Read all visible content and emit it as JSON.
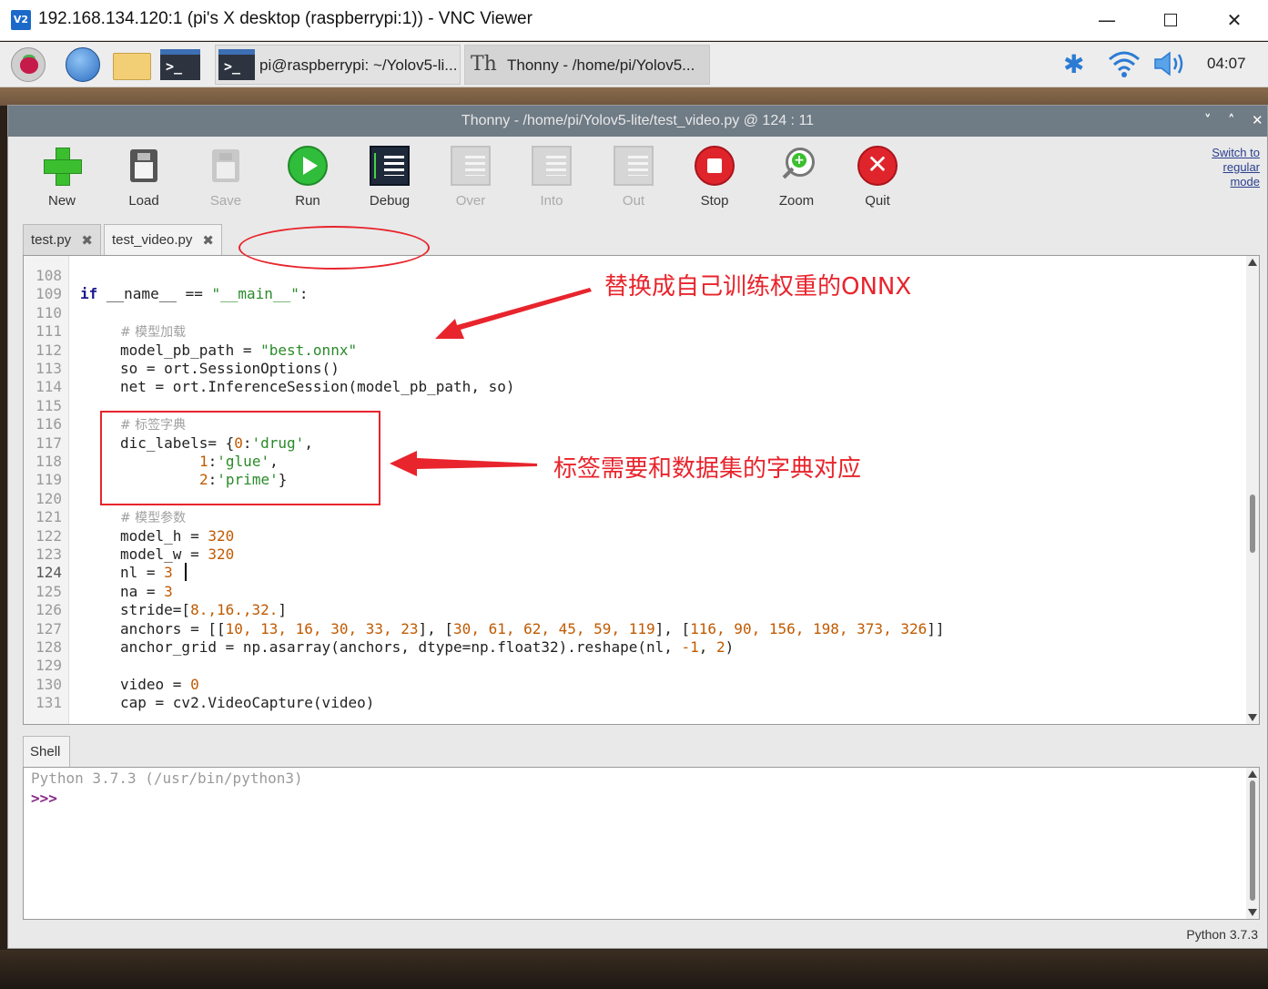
{
  "vnc": {
    "icon_text": "V2",
    "title": "192.168.134.120:1 (pi's X desktop (raspberrypi:1)) - VNC Viewer",
    "min": "—",
    "close": "✕"
  },
  "taskbar": {
    "terminal_prompt": ">_",
    "terminal_task": "pi@raspberrypi: ~/Yolov5-li...",
    "thonny_icon": "Th",
    "thonny_task": "Thonny  -  /home/pi/Yolov5...",
    "bluetooth_glyph": "✱",
    "clock": "04:07"
  },
  "thonny": {
    "title": "Thonny  -  /home/pi/Yolov5-lite/test_video.py  @  124 : 11",
    "ctrl_min": "˅",
    "ctrl_max": "˄",
    "ctrl_close": "✕",
    "toolbar": {
      "new": "New",
      "load": "Load",
      "save": "Save",
      "run": "Run",
      "debug": "Debug",
      "over": "Over",
      "into": "Into",
      "out": "Out",
      "stop": "Stop",
      "zoom": "Zoom",
      "quit": "Quit",
      "zoom_plus": "+",
      "quit_x": "✕"
    },
    "switch_mode": "Switch to regular mode",
    "tabs": [
      {
        "label": "test.py",
        "close": "✖"
      },
      {
        "label": "test_video.py",
        "close": "✖"
      }
    ],
    "line_numbers": [
      "108",
      "109",
      "110",
      "111",
      "112",
      "113",
      "114",
      "115",
      "116",
      "117",
      "118",
      "119",
      "120",
      "121",
      "122",
      "123",
      "124",
      "125",
      "126",
      "127",
      "128",
      "129",
      "130",
      "131"
    ],
    "code": {
      "l109_kw": "if",
      "l109_a": " __name__ == ",
      "l109_str": "\"__main__\"",
      "l109_b": ":",
      "l111": "# 模型加载",
      "l112_a": "model_pb_path = ",
      "l112_str": "\"best.onnx\"",
      "l113": "so = ort.SessionOptions()",
      "l114": "net = ort.InferenceSession(model_pb_path, so)",
      "l116": "# 标签字典",
      "l117_a": "dic_labels= {",
      "l117_n": "0",
      "l117_b": ":",
      "l117_s": "'drug'",
      "l117_c": ",",
      "l118_n": "1",
      "l118_b": ":",
      "l118_s": "'glue'",
      "l118_c": ",",
      "l119_n": "2",
      "l119_b": ":",
      "l119_s": "'prime'",
      "l119_c": "}",
      "l121": "# 模型参数",
      "l122_a": "model_h = ",
      "l122_n": "320",
      "l123_a": "model_w = ",
      "l123_n": "320",
      "l124_a": "nl = ",
      "l124_n": "3",
      "l125_a": "na = ",
      "l125_n": "3",
      "l126_a": "stride=[",
      "l126_n": "8.,16.,32.",
      "l126_b": "]",
      "l127_a": "anchors = [[",
      "l127_n1": "10, 13, 16, 30, 33, 23",
      "l127_b": "], [",
      "l127_n2": "30, 61, 62, 45, 59, 119",
      "l127_c": "], [",
      "l127_n3": "116, 90, 156, 198, 373, 326",
      "l127_d": "]]",
      "l128_a": "anchor_grid = np.asarray(anchors, dtype=np.float32).reshape(nl, ",
      "l128_n1": "-1",
      "l128_b": ", ",
      "l128_n2": "2",
      "l128_c": ")",
      "l130_a": "video = ",
      "l130_n": "0",
      "l131": "cap = cv2.VideoCapture(video)"
    },
    "annotations": {
      "onnx_note": "替换成自己训练权重的ONNX",
      "labels_note": "标签需要和数据集的字典对应"
    },
    "shell": {
      "tab": "Shell",
      "banner": "Python 3.7.3 (/usr/bin/python3)",
      "prompt": ">>>"
    },
    "status": "Python 3.7.3"
  },
  "colors": {
    "annotation_red": "#e8242c",
    "thonny_titlebar": "#6f7b85",
    "keyword": "#1a1a8f",
    "string": "#2a8a2a",
    "number": "#c05a00"
  }
}
